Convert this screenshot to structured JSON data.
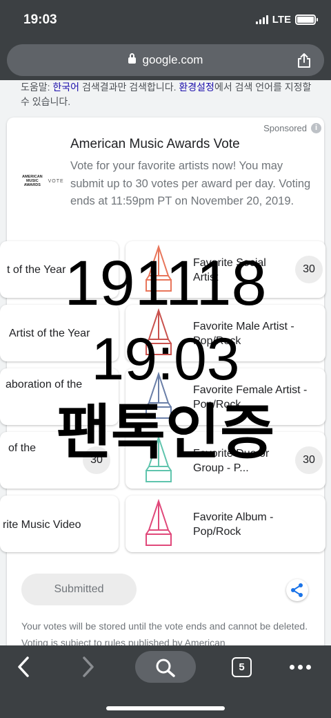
{
  "status": {
    "time": "19:03",
    "network": "LTE"
  },
  "browser": {
    "url": "google.com"
  },
  "lang_note": {
    "prefix": "도움말: ",
    "lang_link": "한국어",
    "middle": " 검색결과만 검색합니다. ",
    "settings_link": "환경설정",
    "suffix": "에서 검색 언어를 지정할 수 있습니다."
  },
  "ad": {
    "sponsored": "Sponsored",
    "logo_text": "AMERICAN MUSIC AWARDS",
    "logo_vote": "VOTE",
    "title": "American Music Awards Vote",
    "description": "Vote for your favorite artists now! You may submit up to 30 votes per award per day. Voting ends at 11:59pm PT on November 20, 2019."
  },
  "left_tiles": [
    {
      "label": "t of the Year"
    },
    {
      "label": "Artist of the Year"
    },
    {
      "label": "aboration of the"
    },
    {
      "label": "of the",
      "count": "30"
    },
    {
      "label": "rite Music Video"
    }
  ],
  "right_tiles": [
    {
      "label": "Favorite Social Artist",
      "count": "30",
      "color": "#e8755a"
    },
    {
      "label": "Favorite Male Artist - Pop/Rock",
      "color": "#c9524e"
    },
    {
      "label": "Favorite Female Artist - Pop/Rock",
      "color": "#6a7fa8"
    },
    {
      "label": "Favorite Duo or Group - P...",
      "count": "30",
      "color": "#5fc4ad"
    },
    {
      "label": "Favorite Album - Pop/Rock",
      "color": "#e0487a"
    }
  ],
  "submitted_label": "Submitted",
  "disclaimer": "Your votes will be stored until the vote ends and cannot be deleted. Voting is subject to rules published by American",
  "overlay": {
    "line1": "191118",
    "line2": "19:03",
    "line3": "팬톡인증"
  },
  "bottom_nav": {
    "tabs_count": "5"
  }
}
